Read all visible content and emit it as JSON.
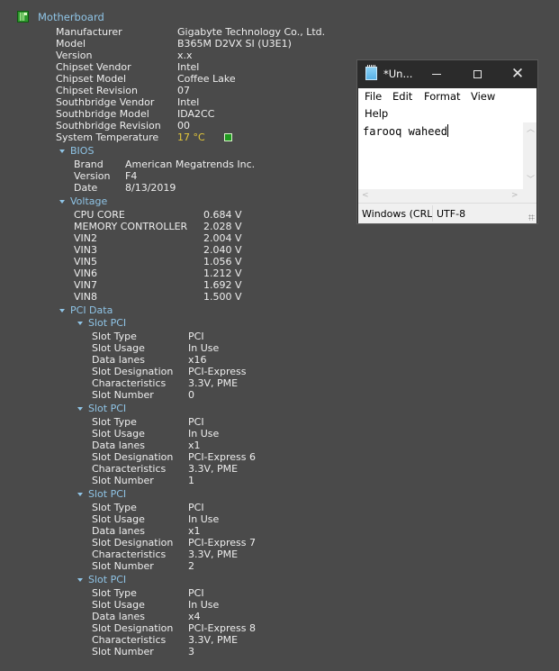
{
  "tree": {
    "root_title": "Motherboard",
    "motherboard_rows": [
      {
        "key": "Manufacturer",
        "value": "Gigabyte Technology Co., Ltd."
      },
      {
        "key": "Model",
        "value": "B365M D2VX SI (U3E1)"
      },
      {
        "key": "Version",
        "value": "x.x"
      },
      {
        "key": "Chipset Vendor",
        "value": "Intel"
      },
      {
        "key": "Chipset Model",
        "value": "Coffee Lake"
      },
      {
        "key": "Chipset Revision",
        "value": "07"
      },
      {
        "key": "Southbridge Vendor",
        "value": "Intel"
      },
      {
        "key": "Southbridge Model",
        "value": "IDA2CC"
      },
      {
        "key": "Southbridge Revision",
        "value": "00"
      },
      {
        "key": "System Temperature",
        "value": "17 °C"
      }
    ],
    "bios": {
      "title": "BIOS",
      "rows": [
        {
          "key": "Brand",
          "value": "American Megatrends Inc."
        },
        {
          "key": "Version",
          "value": "F4"
        },
        {
          "key": "Date",
          "value": "8/13/2019"
        }
      ]
    },
    "voltage": {
      "title": "Voltage",
      "rows": [
        {
          "key": "CPU CORE",
          "value": "0.684 V"
        },
        {
          "key": "MEMORY CONTROLLER",
          "value": "2.028 V"
        },
        {
          "key": "VIN2",
          "value": "2.004 V"
        },
        {
          "key": "VIN3",
          "value": "2.040 V"
        },
        {
          "key": "VIN5",
          "value": "1.056 V"
        },
        {
          "key": "VIN6",
          "value": "1.212 V"
        },
        {
          "key": "VIN7",
          "value": "1.692 V"
        },
        {
          "key": "VIN8",
          "value": "1.500 V"
        }
      ]
    },
    "pci": {
      "title": "PCI Data",
      "slots": [
        {
          "title": "Slot PCI",
          "rows": [
            {
              "key": "Slot Type",
              "value": "PCI"
            },
            {
              "key": "Slot Usage",
              "value": "In Use"
            },
            {
              "key": "Data lanes",
              "value": "x16"
            },
            {
              "key": "Slot Designation",
              "value": "PCI-Express"
            },
            {
              "key": "Characteristics",
              "value": "3.3V, PME"
            },
            {
              "key": "Slot Number",
              "value": "0"
            }
          ]
        },
        {
          "title": "Slot PCI",
          "rows": [
            {
              "key": "Slot Type",
              "value": "PCI"
            },
            {
              "key": "Slot Usage",
              "value": "In Use"
            },
            {
              "key": "Data lanes",
              "value": "x1"
            },
            {
              "key": "Slot Designation",
              "value": "PCI-Express 6"
            },
            {
              "key": "Characteristics",
              "value": "3.3V, PME"
            },
            {
              "key": "Slot Number",
              "value": "1"
            }
          ]
        },
        {
          "title": "Slot PCI",
          "rows": [
            {
              "key": "Slot Type",
              "value": "PCI"
            },
            {
              "key": "Slot Usage",
              "value": "In Use"
            },
            {
              "key": "Data lanes",
              "value": "x1"
            },
            {
              "key": "Slot Designation",
              "value": "PCI-Express 7"
            },
            {
              "key": "Characteristics",
              "value": "3.3V, PME"
            },
            {
              "key": "Slot Number",
              "value": "2"
            }
          ]
        },
        {
          "title": "Slot PCI",
          "rows": [
            {
              "key": "Slot Type",
              "value": "PCI"
            },
            {
              "key": "Slot Usage",
              "value": "In Use"
            },
            {
              "key": "Data lanes",
              "value": "x4"
            },
            {
              "key": "Slot Designation",
              "value": "PCI-Express 8"
            },
            {
              "key": "Characteristics",
              "value": "3.3V, PME"
            },
            {
              "key": "Slot Number",
              "value": "3"
            }
          ]
        }
      ]
    }
  },
  "notepad": {
    "title": "*Un...",
    "menu": [
      "File",
      "Edit",
      "Format",
      "View",
      "Help"
    ],
    "content": "farooq waheed",
    "status_line_ending": "Windows (CRL",
    "status_encoding": "UTF-8"
  },
  "colors": {
    "background": "#4a4a4a",
    "section_title": "#8fc4e6",
    "temperature": "#e4c83a",
    "text": "#eeeeee"
  }
}
